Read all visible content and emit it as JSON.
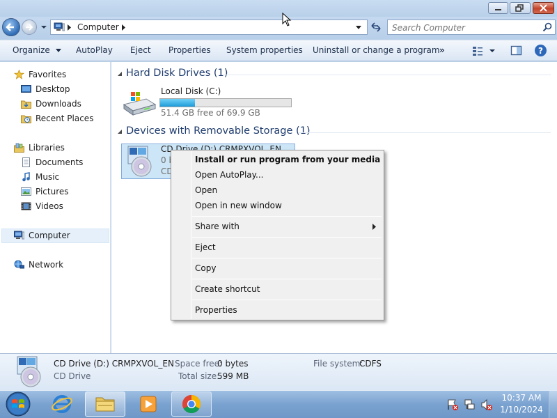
{
  "window": {
    "minimize_label": "Minimize",
    "maximize_label": "Maximize",
    "close_label": "Close"
  },
  "address_bar": {
    "crumb": "Computer",
    "search_placeholder": "Search Computer"
  },
  "toolbar": {
    "items": [
      "Organize",
      "AutoPlay",
      "Eject",
      "Properties",
      "System properties",
      "Uninstall or change a program"
    ],
    "more": "»"
  },
  "nav": {
    "favorites": "Favorites",
    "desktop": "Desktop",
    "downloads": "Downloads",
    "recent_places": "Recent Places",
    "libraries": "Libraries",
    "documents": "Documents",
    "music": "Music",
    "pictures": "Pictures",
    "videos": "Videos",
    "computer": "Computer",
    "network": "Network"
  },
  "content": {
    "hdd_group": "Hard Disk Drives (1)",
    "removable_group": "Devices with Removable Storage (1)",
    "local_disk": {
      "name": "Local Disk (C:)",
      "free": "51.4 GB free of 69.9 GB",
      "used_fraction": 0.265
    },
    "cd_drive": {
      "name": "CD Drive (D:) CRMPXVOL_EN",
      "line2": "0 b",
      "line3": "CD"
    }
  },
  "context_menu": {
    "install": "Install or run program from your media",
    "open_autoplay": "Open AutoPlay...",
    "open": "Open",
    "open_new_window": "Open in new window",
    "share_with": "Share with",
    "eject": "Eject",
    "copy": "Copy",
    "create_shortcut": "Create shortcut",
    "properties": "Properties"
  },
  "details": {
    "name": "CD Drive (D:) CRMPXVOL_EN",
    "type": "CD Drive",
    "space_free_label": "Space free:",
    "space_free": "0 bytes",
    "total_size_label": "Total size:",
    "total_size": "599 MB",
    "fs_label": "File system:",
    "fs": "CDFS"
  },
  "taskbar": {
    "time": "10:37 AM",
    "date": "1/10/2024"
  },
  "colors": {
    "accent": "#26a0da",
    "selection": "#cce4f7",
    "group_header": "#1e3c6e"
  }
}
